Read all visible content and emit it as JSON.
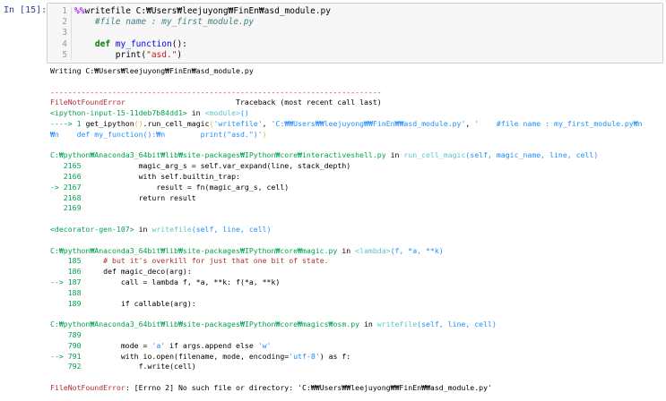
{
  "prompt": "In [15]:",
  "input": {
    "line_numbers": [
      "1",
      "2",
      "3",
      "4",
      "5"
    ],
    "lines": [
      [
        {
          "t": "%%",
          "c": "mg"
        },
        {
          "t": "writefile C:₩Users₩leejuyong₩FinEn₩asd_module.py",
          "c": ""
        }
      ],
      [
        {
          "t": "    #file name : my_first_module.py",
          "c": "cm"
        }
      ],
      [
        {
          "t": "",
          "c": ""
        }
      ],
      [
        {
          "t": "    ",
          "c": ""
        },
        {
          "t": "def",
          "c": "k"
        },
        {
          "t": " ",
          "c": ""
        },
        {
          "t": "my_function",
          "c": "f"
        },
        {
          "t": "():",
          "c": ""
        }
      ],
      [
        {
          "t": "        print(",
          "c": ""
        },
        {
          "t": "\"asd.\"",
          "c": "s"
        },
        {
          "t": ")",
          "c": ""
        }
      ]
    ]
  },
  "output": {
    "lines": [
      [
        {
          "t": "Writing C:₩Users₩leejuyong₩FinEn₩asd_module.py",
          "c": ""
        }
      ],
      [
        {
          "t": "",
          "c": ""
        }
      ],
      [
        {
          "t": "---------------------------------------------------------------------------",
          "c": "sep"
        }
      ],
      [
        {
          "t": "FileNotFoundError",
          "c": "r"
        },
        {
          "t": "                         Traceback (most recent call last)",
          "c": ""
        }
      ],
      [
        {
          "t": "<ipython-input-15-11deb7b84dd1>",
          "c": "g"
        },
        {
          "t": " in ",
          "c": ""
        },
        {
          "t": "<module>",
          "c": "cy"
        },
        {
          "t": "()",
          "c": "b"
        }
      ],
      [
        {
          "t": "----> 1 ",
          "c": "g"
        },
        {
          "t": "get_ipython",
          "c": ""
        },
        {
          "t": "(",
          "c": "y"
        },
        {
          "t": ")",
          "c": "y"
        },
        {
          "t": ".",
          "c": ""
        },
        {
          "t": "run_cell_magic",
          "c": ""
        },
        {
          "t": "(",
          "c": "y"
        },
        {
          "t": "'writefile'",
          "c": "b"
        },
        {
          "t": ", ",
          "c": ""
        },
        {
          "t": "'C:₩₩Users₩₩leejuyong₩₩FinEn₩₩asd_module.py'",
          "c": "b"
        },
        {
          "t": ", ",
          "c": ""
        },
        {
          "t": "'    #file name : my_first_module.py₩n",
          "c": "b"
        }
      ],
      [
        {
          "t": "₩n    def my_function():₩n        print(\"asd.\")'",
          "c": "b"
        },
        {
          "t": ")",
          "c": "y"
        }
      ],
      [
        {
          "t": "",
          "c": ""
        }
      ],
      [
        {
          "t": "C:₩python₩Anaconda3_64bit₩lib₩site-packages₩IPython₩core₩interactiveshell.py",
          "c": "g"
        },
        {
          "t": " in ",
          "c": ""
        },
        {
          "t": "run_cell_magic",
          "c": "cy"
        },
        {
          "t": "(self, magic_name, line, cell)",
          "c": "b"
        }
      ],
      [
        {
          "t": "   2165",
          "c": "g"
        },
        {
          "t": "             magic_arg_s = self.var_expand(line, stack_depth)",
          "c": ""
        }
      ],
      [
        {
          "t": "   2166",
          "c": "g"
        },
        {
          "t": "             with self.builtin_trap:",
          "c": ""
        }
      ],
      [
        {
          "t": "-> 2167",
          "c": "g"
        },
        {
          "t": "                 result = fn(magic_arg_s, cell)",
          "c": ""
        }
      ],
      [
        {
          "t": "   2168",
          "c": "g"
        },
        {
          "t": "             return result",
          "c": ""
        }
      ],
      [
        {
          "t": "   2169",
          "c": "g"
        }
      ],
      [
        {
          "t": "",
          "c": ""
        }
      ],
      [
        {
          "t": "<decorator-gen-107>",
          "c": "g"
        },
        {
          "t": " in ",
          "c": ""
        },
        {
          "t": "writefile",
          "c": "cy"
        },
        {
          "t": "(self, line, cell)",
          "c": "b"
        }
      ],
      [
        {
          "t": "",
          "c": ""
        }
      ],
      [
        {
          "t": "C:₩python₩Anaconda3_64bit₩lib₩site-packages₩IPython₩core₩magic.py",
          "c": "g"
        },
        {
          "t": " in ",
          "c": ""
        },
        {
          "t": "<lambda>",
          "c": "cy"
        },
        {
          "t": "(f, *a, **k)",
          "c": "b"
        }
      ],
      [
        {
          "t": "    185",
          "c": "g"
        },
        {
          "t": "     # but it's overkill for just that one bit of state.",
          "c": "rb"
        }
      ],
      [
        {
          "t": "    186",
          "c": "g"
        },
        {
          "t": "     def magic_deco(arg):",
          "c": ""
        }
      ],
      [
        {
          "t": "--> 187",
          "c": "g"
        },
        {
          "t": "         call = lambda f, *a, **k: f(*a, **k)",
          "c": ""
        }
      ],
      [
        {
          "t": "    188",
          "c": "g"
        }
      ],
      [
        {
          "t": "    189",
          "c": "g"
        },
        {
          "t": "         if callable(arg):",
          "c": ""
        }
      ],
      [
        {
          "t": "",
          "c": ""
        }
      ],
      [
        {
          "t": "C:₩python₩Anaconda3_64bit₩lib₩site-packages₩IPython₩core₩magics₩osm.py",
          "c": "g"
        },
        {
          "t": " in ",
          "c": ""
        },
        {
          "t": "writefile",
          "c": "cy"
        },
        {
          "t": "(self, line, cell)",
          "c": "b"
        }
      ],
      [
        {
          "t": "    789",
          "c": "g"
        }
      ],
      [
        {
          "t": "    790",
          "c": "g"
        },
        {
          "t": "         mode = ",
          "c": ""
        },
        {
          "t": "'a'",
          "c": "b"
        },
        {
          "t": " if args.append else ",
          "c": ""
        },
        {
          "t": "'w'",
          "c": "b"
        }
      ],
      [
        {
          "t": "--> 791",
          "c": "g"
        },
        {
          "t": "         with io.open(filename, mode, encoding=",
          "c": ""
        },
        {
          "t": "'utf-8'",
          "c": "b"
        },
        {
          "t": ") as f:",
          "c": ""
        }
      ],
      [
        {
          "t": "    792",
          "c": "g"
        },
        {
          "t": "             f.write(cell)",
          "c": ""
        }
      ],
      [
        {
          "t": "",
          "c": ""
        }
      ],
      [
        {
          "t": "FileNotFoundError",
          "c": "r"
        },
        {
          "t": ": [Errno 2] No such file or directory: 'C:₩₩Users₩₩leejuyong₩₩FinEn₩₩asd_module.py'",
          "c": ""
        }
      ]
    ]
  }
}
